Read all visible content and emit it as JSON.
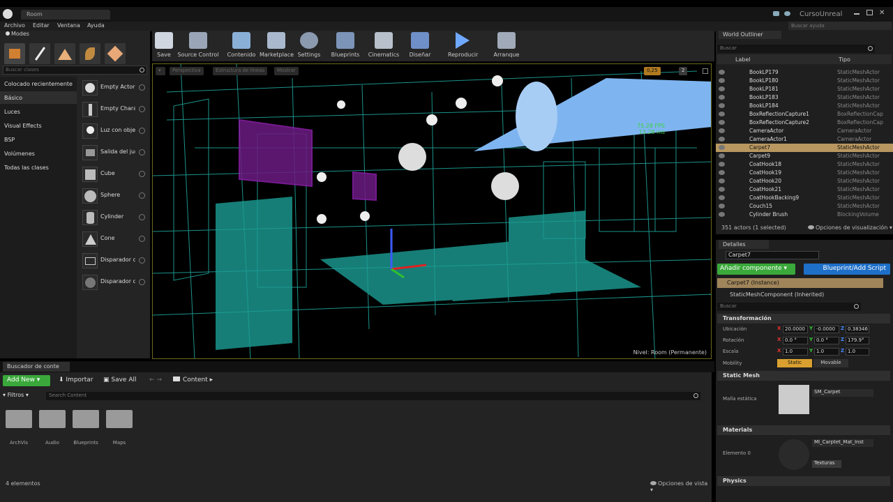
{
  "title_bar": {
    "tab": "Room",
    "project": "CursoUnreal"
  },
  "menu": [
    "Archivo",
    "Editar",
    "Ventana",
    "Ayuda"
  ],
  "help_search_placeholder": "Buscar ayuda",
  "modes": {
    "title": "Modes",
    "search_placeholder": "Buscar clases",
    "categories": [
      "Colocado recientemente",
      "Básico",
      "Luces",
      "Visual Effects",
      "BSP",
      "Volúmenes",
      "Todas las clases"
    ],
    "actors": [
      "Empty Actor",
      "Empty Chara",
      "Luz con obje",
      "Salida del jug",
      "Cube",
      "Sphere",
      "Cylinder",
      "Cone",
      "Disparador c",
      "Disparador c"
    ]
  },
  "toolbar": [
    "Save",
    "Source Control",
    "Contenido",
    "Marketplace",
    "Settings",
    "Blueprints",
    "Cinematics",
    "Diseñar",
    "Reproducir",
    "Arranque"
  ],
  "viewport": {
    "buttons": [
      "Perspectiva",
      "Estructura de líneas",
      "Mostrar"
    ],
    "fps": "75.28 FPS",
    "ms": "13.28 ms",
    "snap_value": "0,25",
    "camera_speed": "2",
    "level_label": "Nivel:",
    "level_name": "Room (Permanente)"
  },
  "outliner": {
    "title": "World Outliner",
    "search_placeholder": "Buscar",
    "col_label": "Label",
    "col_type": "Tipo",
    "rows": [
      {
        "label": "BookLP179",
        "type": "StaticMeshActor"
      },
      {
        "label": "BookLP180",
        "type": "StaticMeshActor"
      },
      {
        "label": "BookLP181",
        "type": "StaticMeshActor"
      },
      {
        "label": "BookLP183",
        "type": "StaticMeshActor"
      },
      {
        "label": "BookLP184",
        "type": "StaticMeshActor"
      },
      {
        "label": "BoxReflectionCapture1",
        "type": "BoxReflectionCap"
      },
      {
        "label": "BoxReflectionCapture2",
        "type": "BoxReflectionCap"
      },
      {
        "label": "CameraActor",
        "type": "CameraActor"
      },
      {
        "label": "CameraActor1",
        "type": "CameraActor"
      },
      {
        "label": "Carpet7",
        "type": "StaticMeshActor"
      },
      {
        "label": "Carpet9",
        "type": "StaticMeshActor"
      },
      {
        "label": "CoatHook18",
        "type": "StaticMeshActor"
      },
      {
        "label": "CoatHook19",
        "type": "StaticMeshActor"
      },
      {
        "label": "CoatHook20",
        "type": "StaticMeshActor"
      },
      {
        "label": "CoatHook21",
        "type": "StaticMeshActor"
      },
      {
        "label": "CoatHookBacking9",
        "type": "StaticMeshActor"
      },
      {
        "label": "Couch15",
        "type": "StaticMeshActor"
      },
      {
        "label": "Cylinder Brush",
        "type": "BlockingVolume"
      }
    ],
    "status": "351 actors (1 selected)",
    "view_options": "Opciones de visualización"
  },
  "details": {
    "title": "Detalles",
    "name_value": "Carpet7",
    "add_component": "Añadir componente",
    "blueprint_button": "Blueprint/Add Script",
    "instance": "Carpet7 (Instance)",
    "component": "StaticMeshComponent (Inherited)",
    "search_placeholder": "Buscar",
    "transform_title": "Transformación",
    "location_label": "Ubicación",
    "rotation_label": "Rotación",
    "scale_label": "Escala",
    "mobility_label": "Mobility",
    "location": [
      "20.0000",
      "-0.0000",
      "0.38346"
    ],
    "rotation": [
      "0.0 °",
      "0.0 °",
      "179.9°"
    ],
    "scale": [
      "1.0",
      "1.0",
      "1.0"
    ],
    "mobility_static": "Static",
    "mobility_movable": "Movable",
    "static_mesh_title": "Static Mesh",
    "mesh_label": "Malla estática",
    "mesh_value": "SM_Carpet",
    "materials_title": "Materials",
    "element_label": "Elemento 0",
    "material_value": "MI_Carptet_Mat_Inst",
    "textures_button": "Texturas",
    "physics_title": "Physics"
  },
  "content_browser": {
    "tab": "Buscador de conte",
    "add_new": "Add New",
    "import": "Importar",
    "save_all": "Save All",
    "path": "Content",
    "filters": "Filtros",
    "search_placeholder": "Search Content",
    "folders": [
      "ArchVis",
      "Audio",
      "Blueprints",
      "Maps"
    ],
    "count": "4 elementos",
    "view_options": "Opciones de vista"
  }
}
